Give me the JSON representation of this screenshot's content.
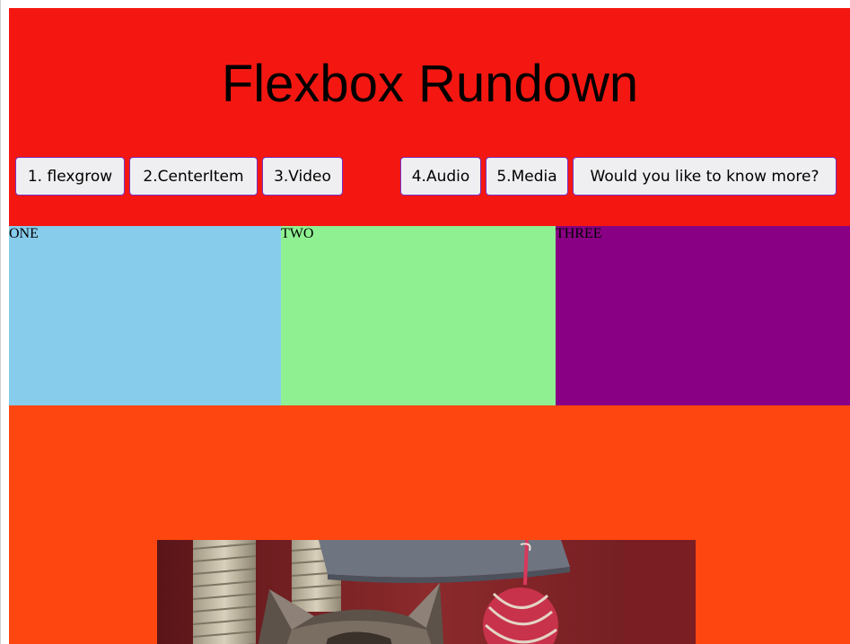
{
  "header": {
    "title": "Flexbox Rundown"
  },
  "nav": {
    "items": [
      {
        "label": "1. flexgrow"
      },
      {
        "label": "2.CenterItem"
      },
      {
        "label": "3.Video"
      },
      {
        "label": "4.Audio"
      },
      {
        "label": "5.Media"
      },
      {
        "label": "Would you like to know more?"
      }
    ]
  },
  "boxes": [
    {
      "label": "ONE",
      "color": "#87cceb"
    },
    {
      "label": "TWO",
      "color": "#8ff092"
    },
    {
      "label": "THREE",
      "color": "#8a0084"
    }
  ],
  "colors": {
    "header_bg": "#f41711",
    "media_bg": "#fd4610",
    "button_border": "#7b2fbf"
  },
  "media": {
    "image": "kitten-photo"
  }
}
